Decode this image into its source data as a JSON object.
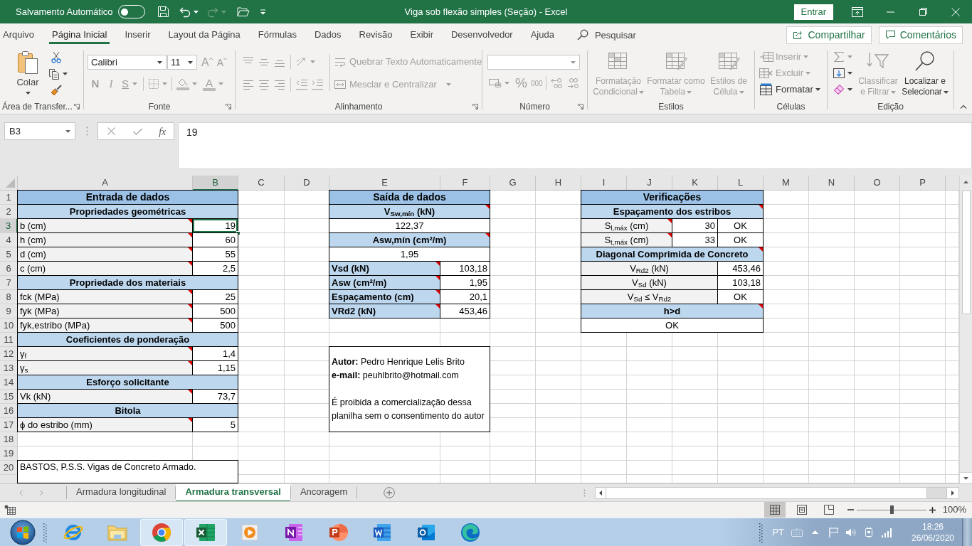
{
  "title_bar": {
    "autosave_label": "Salvamento Automático",
    "autosave_on": false,
    "redo_disabled": true,
    "title": "Viga sob flexão simples (Seção) - Excel",
    "sign_in": "Entrar"
  },
  "menu_tabs": [
    {
      "label": "Arquivo",
      "selected": false
    },
    {
      "label": "Página Inicial",
      "selected": true
    },
    {
      "label": "Inserir",
      "selected": false
    },
    {
      "label": "Layout da Página",
      "selected": false
    },
    {
      "label": "Fórmulas",
      "selected": false
    },
    {
      "label": "Dados",
      "selected": false
    },
    {
      "label": "Revisão",
      "selected": false
    },
    {
      "label": "Exibir",
      "selected": false
    },
    {
      "label": "Desenvolvedor",
      "selected": false
    },
    {
      "label": "Ajuda",
      "selected": false
    }
  ],
  "search": {
    "placeholder": "Pesquisar"
  },
  "share_button": "Compartilhar",
  "comments_button": "Comentários",
  "ribbon": {
    "clipboard": {
      "label": "Área de Transfer...",
      "paste": "Colar"
    },
    "font": {
      "label": "Fonte",
      "font_name": "Calibri",
      "font_size": "11",
      "grow": "A",
      "shrink": "A",
      "style_buttons": [
        {
          "kind": "bold",
          "label": "N",
          "disabled": true
        },
        {
          "kind": "italic",
          "label": "I",
          "disabled": true
        },
        {
          "kind": "underline",
          "label": "S",
          "disabled": true
        }
      ],
      "font_color": "A"
    },
    "alignment": {
      "label": "Alinhamento",
      "buttons": [
        {
          "kind": "wrap",
          "label": "Quebrar Texto Automaticamente",
          "disabled": true
        },
        {
          "kind": "merge",
          "label": "Mesclar e Centralizar",
          "disabled": true
        }
      ]
    },
    "number": {
      "label": "Número",
      "percent": "%",
      "thousands": "000"
    },
    "styles": {
      "label": "Estilos",
      "buttons": [
        {
          "kind": "conditional",
          "lines": [
            "Formatação",
            "Condicional"
          ],
          "disabled": true
        },
        {
          "kind": "table",
          "lines": [
            "Formatar como",
            "Tabela"
          ],
          "disabled": true
        },
        {
          "kind": "cell_styles",
          "lines": [
            "Estilos de",
            "Célula"
          ],
          "disabled": true
        }
      ]
    },
    "cells": {
      "label": "Células",
      "buttons": [
        {
          "kind": "insert",
          "label": "Inserir",
          "disabled": true
        },
        {
          "kind": "delete",
          "label": "Excluir",
          "disabled": true
        },
        {
          "kind": "format",
          "label": "Formatar",
          "disabled": false
        }
      ]
    },
    "editing": {
      "label": "Edição",
      "buttons": [
        {
          "kind": "sort",
          "lines": [
            "Classificar",
            "e Filtrar"
          ],
          "disabled": true
        },
        {
          "kind": "find",
          "lines": [
            "Localizar e",
            "Selecionar"
          ],
          "disabled": false
        }
      ]
    }
  },
  "formula_bar": {
    "name_box": "B3",
    "function_button": "fx",
    "value": "19"
  },
  "sheet": {
    "columns": [
      {
        "label": "A",
        "selected": false
      },
      {
        "label": "B",
        "selected": true
      },
      {
        "label": "C",
        "selected": false
      },
      {
        "label": "D",
        "selected": false
      },
      {
        "label": "E",
        "selected": false
      },
      {
        "label": "F",
        "selected": false
      },
      {
        "label": "G",
        "selected": false
      },
      {
        "label": "H",
        "selected": false
      },
      {
        "label": "I",
        "selected": false
      },
      {
        "label": "J",
        "selected": false
      },
      {
        "label": "K",
        "selected": false
      },
      {
        "label": "L",
        "selected": false
      },
      {
        "label": "M",
        "selected": false
      },
      {
        "label": "N",
        "selected": false
      },
      {
        "label": "O",
        "selected": false
      },
      {
        "label": "P",
        "selected": false
      }
    ],
    "rows": [
      {
        "label": "1",
        "selected": false
      },
      {
        "label": "2",
        "selected": false
      },
      {
        "label": "3",
        "selected": true
      },
      {
        "label": "4",
        "selected": false
      },
      {
        "label": "5",
        "selected": false
      },
      {
        "label": "6",
        "selected": false
      },
      {
        "label": "7",
        "selected": false
      },
      {
        "label": "8",
        "selected": false
      },
      {
        "label": "9",
        "selected": false
      },
      {
        "label": "10",
        "selected": false
      },
      {
        "label": "11",
        "selected": false
      },
      {
        "label": "12",
        "selected": false
      },
      {
        "label": "13",
        "selected": false
      },
      {
        "label": "14",
        "selected": false
      },
      {
        "label": "15",
        "selected": false
      },
      {
        "label": "16",
        "selected": false
      },
      {
        "label": "17",
        "selected": false
      },
      {
        "label": "18",
        "selected": false
      },
      {
        "label": "19",
        "selected": false
      },
      {
        "label": "20",
        "selected": false
      }
    ],
    "input_table": {
      "rows": [
        {
          "kind": "title",
          "text": "Entrada de dados",
          "comment": false
        },
        {
          "kind": "section",
          "text": "Propriedades geométricas",
          "comment": false
        },
        {
          "kind": "field",
          "label": "b (cm)",
          "value": "19",
          "comment": true
        },
        {
          "kind": "field",
          "label": "h (cm)",
          "value": "60",
          "comment": true
        },
        {
          "kind": "field",
          "label": "d (cm)",
          "value": "55",
          "comment": true
        },
        {
          "kind": "field",
          "label": "c (cm)",
          "value": "2,5",
          "comment": true
        },
        {
          "kind": "section",
          "text": "Propriedade dos materiais",
          "comment": false
        },
        {
          "kind": "field",
          "label": "fck (MPa)",
          "value": "25",
          "comment": true
        },
        {
          "kind": "field",
          "label": "fyk (MPa)",
          "value": "500",
          "comment": true
        },
        {
          "kind": "field",
          "label": "fyk,estribo (MPa)",
          "value": "500",
          "comment": true
        },
        {
          "kind": "section",
          "text": "Coeficientes de ponderação",
          "comment": false
        },
        {
          "kind": "field",
          "label": "γ$_{f}$",
          "value": "1,4",
          "comment": true
        },
        {
          "kind": "field",
          "label": "γ$_{s}$",
          "value": "1,15",
          "comment": true
        },
        {
          "kind": "section",
          "text": "Esforço solicitante",
          "comment": false
        },
        {
          "kind": "field",
          "label": "Vk (kN)",
          "value": "73,7",
          "comment": true
        },
        {
          "kind": "section",
          "text": "Bitola",
          "comment": false
        },
        {
          "kind": "field",
          "label": "ϕ do estribo (mm)",
          "value": "5",
          "comment": true
        }
      ]
    },
    "output_table": {
      "rows": [
        {
          "kind": "title",
          "text": "Saída de dados",
          "comment": false
        },
        {
          "kind": "section",
          "text": "V$_{Sw,mín}$ (kN)",
          "comment": true
        },
        {
          "kind": "result",
          "text": "122,37",
          "comment": false
        },
        {
          "kind": "section",
          "text": "Asw,mín (cm²/m)",
          "comment": true
        },
        {
          "kind": "result",
          "text": "1,95",
          "comment": false
        },
        {
          "kind": "field",
          "label": "Vsd (kN)",
          "value": "103,18",
          "comment": true
        },
        {
          "kind": "field",
          "label": "Asw (cm²/m)",
          "value": "1,95",
          "comment": true
        },
        {
          "kind": "field",
          "label": "Espaçamento (cm)",
          "value": "20,1",
          "comment": true
        },
        {
          "kind": "field",
          "label": "VRd2 (kN)",
          "value": "453,46",
          "comment": true
        }
      ]
    },
    "checks_table": {
      "rows": [
        {
          "kind": "title",
          "text": "Verificações",
          "comment": false
        },
        {
          "kind": "section",
          "text": "Espaçamento dos estribos",
          "comment": true
        },
        {
          "kind": "check",
          "label": "S$_{l,máx}$ (cm)",
          "value": "30",
          "status": "OK",
          "comment": true
        },
        {
          "kind": "check",
          "label": "S$_{t,máx}$ (cm)",
          "value": "33",
          "status": "OK",
          "comment": true
        },
        {
          "kind": "section",
          "text": "Diagonal Comprimida de Concreto",
          "comment": true
        },
        {
          "kind": "field",
          "label": "V$_{Rd2}$ (kN)",
          "value": "453,46",
          "comment": false
        },
        {
          "kind": "field",
          "label": "V$_{Sd}$ (kN)",
          "value": "103,18",
          "comment": false
        },
        {
          "kind": "status_field",
          "label": "V$_{Sd}$ ≤ V$_{Rd2}$",
          "status": "OK",
          "comment": false
        },
        {
          "kind": "section",
          "text": "h>d",
          "comment": true
        },
        {
          "kind": "result",
          "text": "OK",
          "comment": false
        }
      ]
    },
    "author_note": {
      "lines": [
        {
          "kind": "field",
          "text": "**Autor:** Pedro Henrique Lelis Brito"
        },
        {
          "kind": "field",
          "text": "**e-mail:** peuhlbrito@hotmail.com"
        },
        {
          "kind": "paragraph",
          "text": "É proibida a comercialização dessa planilha sem o consentimento do autor"
        }
      ]
    },
    "reference_note": {
      "text": "BASTOS, P.S.S. Vigas de Concreto Armado."
    }
  },
  "sheet_tabs": [
    {
      "label": "Armadura longitudinal",
      "selected": false
    },
    {
      "label": "Armadura transversal",
      "selected": true
    },
    {
      "label": "Ancoragem",
      "selected": false
    }
  ],
  "status_bar": {
    "views": [
      {
        "kind": "normal",
        "selected": true
      },
      {
        "kind": "page_layout",
        "selected": false
      },
      {
        "kind": "page_break",
        "selected": false
      }
    ],
    "zoom": {
      "level": 0.5,
      "label": "100%"
    }
  },
  "taskbar": {
    "apps": [
      {
        "kind": "internet_browser",
        "running": false
      },
      {
        "kind": "file_explorer",
        "running": false
      },
      {
        "kind": "web_browser",
        "running": true
      },
      {
        "kind": "spreadsheet",
        "running": true
      },
      {
        "kind": "media_player",
        "running": false
      },
      {
        "kind": "notebook",
        "running": false
      },
      {
        "kind": "presentation",
        "running": false
      },
      {
        "kind": "word_processor",
        "running": false
      },
      {
        "kind": "email",
        "running": false
      },
      {
        "kind": "edge_browser",
        "running": false
      }
    ],
    "language": "PT",
    "time": "18:26",
    "date": "26/06/2020"
  }
}
